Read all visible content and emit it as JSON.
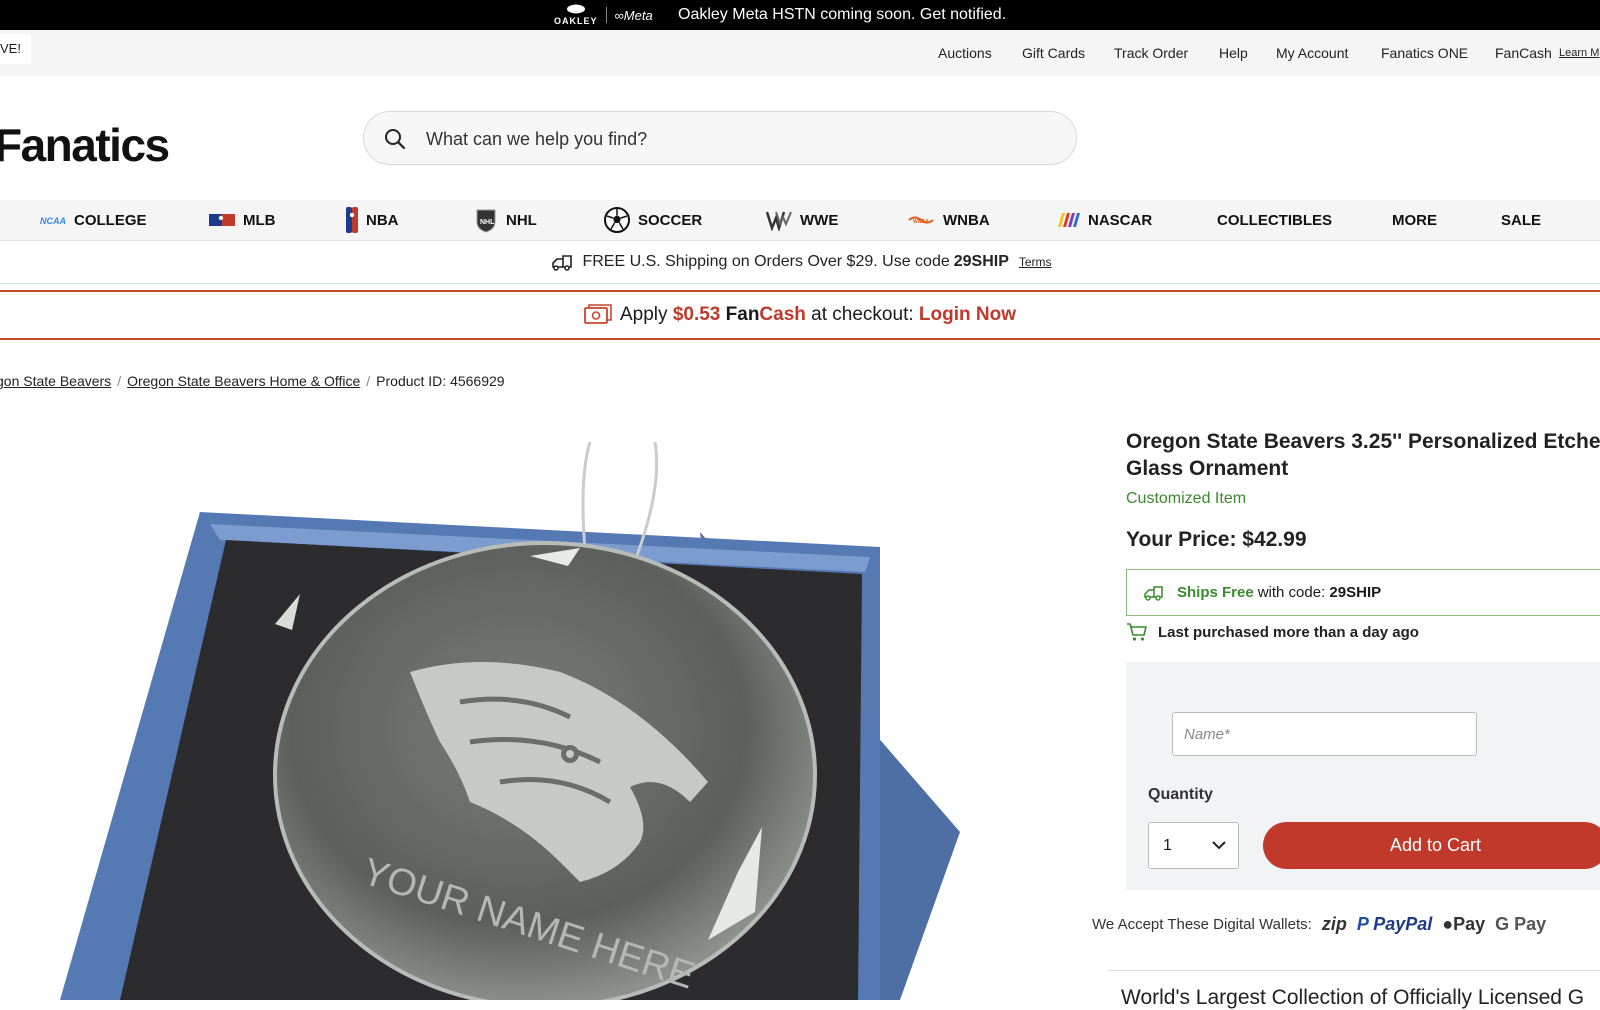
{
  "promo": {
    "brand1": "OAKLEY",
    "brand2": "∞Meta",
    "message": "Oakley Meta HSTN coming soon. Get notified."
  },
  "utility": {
    "save_text": "VE!",
    "links": [
      "Auctions",
      "Gift Cards",
      "Track Order",
      "Help",
      "My Account",
      "Fanatics ONE",
      "FanCash",
      "Learn M"
    ]
  },
  "header": {
    "logo": "Fanatics",
    "search_placeholder": "What can we help you find?"
  },
  "nav": {
    "items": [
      {
        "label": "COLLEGE",
        "icon": "ncaa-icon"
      },
      {
        "label": "MLB",
        "icon": "mlb-icon"
      },
      {
        "label": "NBA",
        "icon": "nba-icon"
      },
      {
        "label": "NHL",
        "icon": "nhl-icon"
      },
      {
        "label": "SOCCER",
        "icon": "soccer-ball-icon"
      },
      {
        "label": "WWE",
        "icon": "wwe-icon"
      },
      {
        "label": "WNBA",
        "icon": "wnba-icon"
      },
      {
        "label": "NASCAR",
        "icon": "nascar-icon"
      },
      {
        "label": "COLLECTIBLES",
        "icon": ""
      },
      {
        "label": "MORE",
        "icon": ""
      },
      {
        "label": "SALE",
        "icon": ""
      }
    ]
  },
  "shipping": {
    "text": "FREE U.S. Shipping on Orders Over $29. Use code",
    "code": "29SHIP",
    "terms": "Terms"
  },
  "fancash": {
    "apply": "Apply",
    "amount": "$0.53",
    "fan": "Fan",
    "cash": "Cash",
    "checkout": "at checkout:",
    "login": "Login Now"
  },
  "breadcrumb": {
    "items": [
      "gon State Beavers",
      "Oregon State Beavers Home & Office"
    ],
    "product_id": "Product ID: 4566929"
  },
  "product": {
    "engraving": "YOUR NAME HERE",
    "title_line1": "Oregon State Beavers 3.25'' Personalized Etche",
    "title_line2": "Glass Ornament",
    "customized": "Customized Item",
    "price": "Your Price: $42.99",
    "ships_free": "Ships Free",
    "ships_code_text": "with code:",
    "ships_code": "29SHIP",
    "last_purchased": "Last purchased more than a day ago",
    "name_placeholder": "Name*",
    "quantity_label": "Quantity",
    "quantity_value": "1",
    "add_to_cart": "Add to Cart",
    "wallets_label": "We Accept These Digital Wallets:",
    "wallets": [
      "zip",
      "PayPal",
      "Pay",
      "G Pay"
    ],
    "world_text": "World's Largest Collection of Officially Licensed G"
  },
  "colors": {
    "accent_red": "#c0392b",
    "green": "#3a8a2e"
  }
}
